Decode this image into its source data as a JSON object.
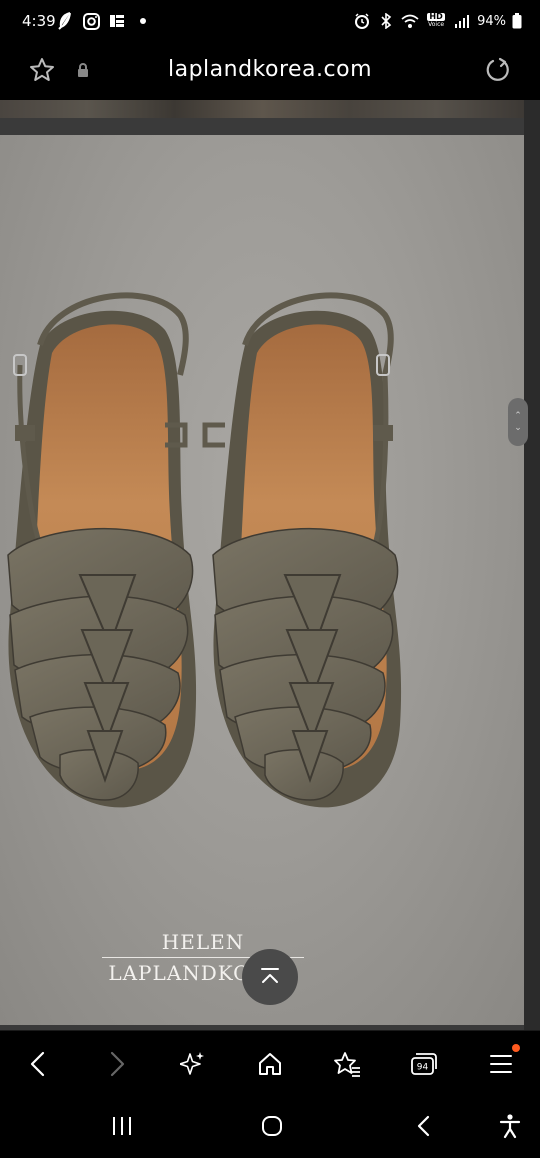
{
  "status_bar": {
    "time": "4:39",
    "battery": "94%",
    "icons": [
      "feather-icon",
      "instagram-icon",
      "news-icon",
      "dot-icon",
      "alarm-icon",
      "bluetooth-icon",
      "wifi-icon",
      "hd-voice-icon",
      "signal-icon",
      "battery-icon"
    ],
    "hd_voice_top": "HD",
    "hd_voice_bottom": "Voice"
  },
  "address_bar": {
    "url": "laplandkorea.com",
    "icons": [
      "star-icon",
      "lock-icon",
      "reload-icon"
    ]
  },
  "page": {
    "brand_line1": "HELEN",
    "brand_line2": "LAPLANDKOREA",
    "scroll_handle_icons": [
      "chevron-up-icon",
      "chevron-down-icon"
    ],
    "image_subject": "pair-of-woven-leather-slingback-sandals"
  },
  "toolbar": {
    "tab_count": "94",
    "buttons": [
      "back-icon",
      "forward-icon",
      "sparkle-icon",
      "home-icon",
      "bookmarks-icon",
      "tabs-icon",
      "menu-icon"
    ]
  },
  "navbar": {
    "buttons": [
      "recents-icon",
      "home-circle-icon",
      "back-icon",
      "accessibility-icon"
    ]
  },
  "colors": {
    "hero_bg": "#9d9b97",
    "leather": "#6f6a5c",
    "footbed": "#b87b4b",
    "menu_badge": "#ff5a1f"
  }
}
